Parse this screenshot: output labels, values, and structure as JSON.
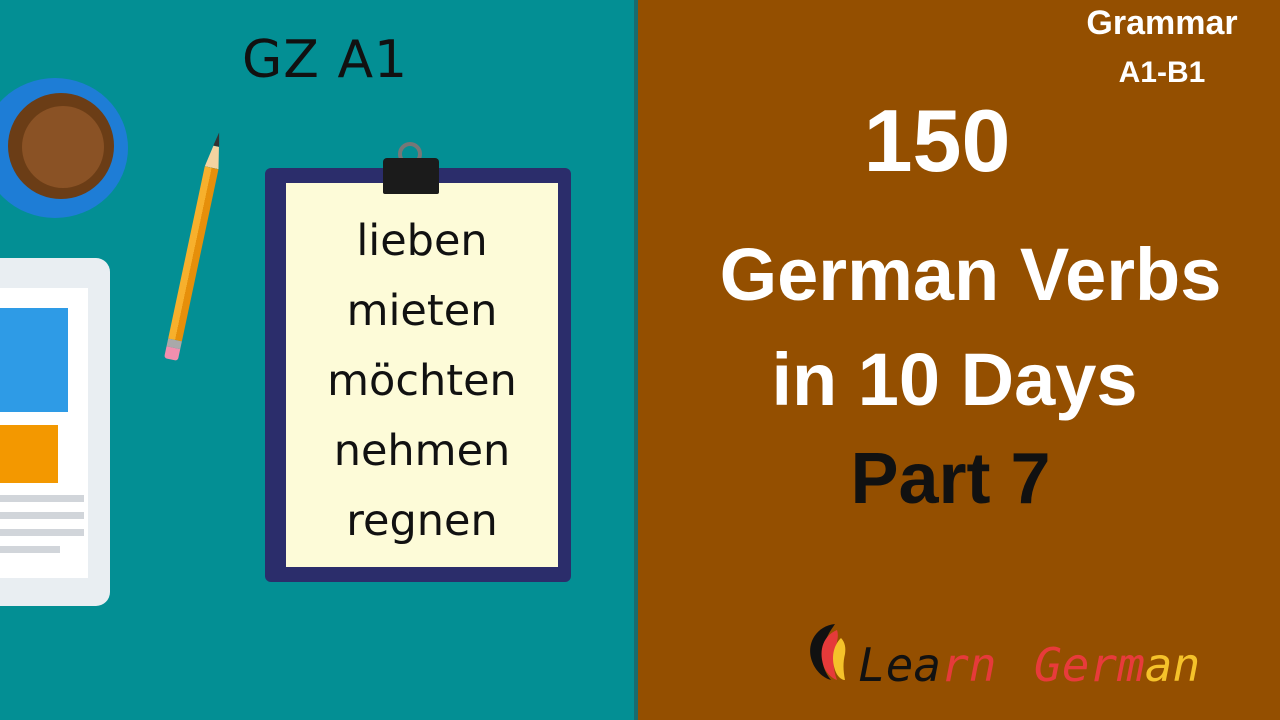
{
  "thumbnail": {
    "left_header": "GZ A1",
    "verbs": [
      "lieben",
      "mieten",
      "möchten",
      "nehmen",
      "regnen"
    ],
    "badge_line1": "Grammar",
    "badge_line2": "A1-B1",
    "headline_number": "150",
    "headline_line1": "German Verbs",
    "headline_line2": "in 10 Days",
    "part_label": "Part 7",
    "brand_a": "Lea",
    "brand_b": "rn",
    "brand_c": "Germ",
    "brand_d": "an"
  },
  "colors": {
    "left_panel": "#038f94",
    "right_panel": "#944f00",
    "clipboard": "#2b2d6b",
    "paper": "#fdfbd8",
    "accent_red": "#e83b3b",
    "accent_yellow": "#f5c22a"
  },
  "icons": [
    "coffee-cup-icon",
    "pencil-icon",
    "tablet-icon",
    "binder-clip-icon",
    "germany-flag-drop-icon"
  ]
}
